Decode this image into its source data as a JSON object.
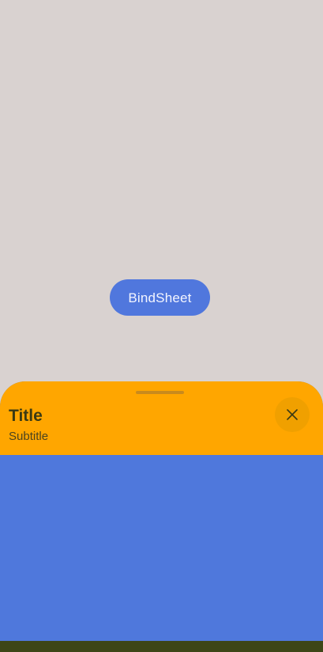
{
  "trigger_button": {
    "label": "BindSheet"
  },
  "sheet": {
    "title": "Title",
    "subtitle": "Subtitle",
    "close_icon": "close-icon"
  },
  "colors": {
    "backdrop": "#d9d2d0",
    "trigger_button": "#5077dd",
    "sheet_header": "#ffa600",
    "sheet_content": "#4f78dc",
    "bottom_bar": "#3d4617"
  }
}
